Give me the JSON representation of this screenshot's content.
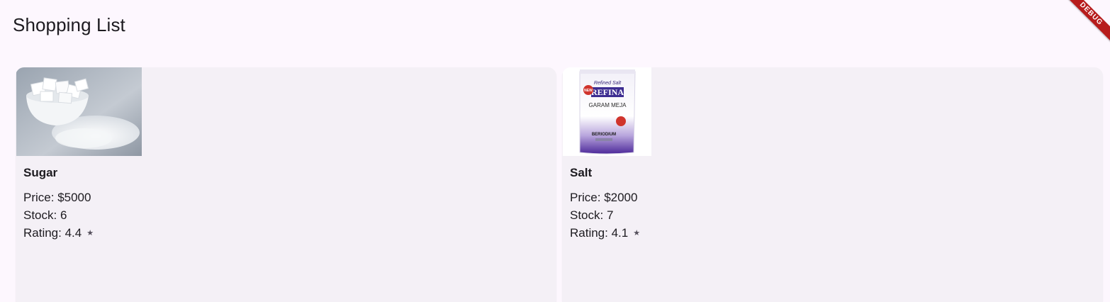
{
  "app": {
    "title": "Shopping List",
    "debug_label": "DEBUG"
  },
  "labels": {
    "price": "Price: ",
    "stock": "Stock: ",
    "rating": "Rating: "
  },
  "products": [
    {
      "name": "Sugar",
      "price": "$5000",
      "stock": "6",
      "rating": "4.4",
      "rating_icon": "star-icon",
      "image": "sugar-bowl-photo"
    },
    {
      "name": "Salt",
      "price": "$2000",
      "stock": "7",
      "rating": "4.1",
      "rating_icon": "star-icon",
      "image": "salt-package-photo",
      "package_text": {
        "top": "Refined Salt",
        "brand": "REFINA",
        "sub": "GARAM MEJA",
        "bottom": "BERIODIUM",
        "badge": "NEW"
      }
    }
  ],
  "colors": {
    "background": "#fdf7fe",
    "card": "#f4f0f6",
    "debug_banner": "#b71c1c",
    "salt_purple": "#5b2ea6"
  }
}
